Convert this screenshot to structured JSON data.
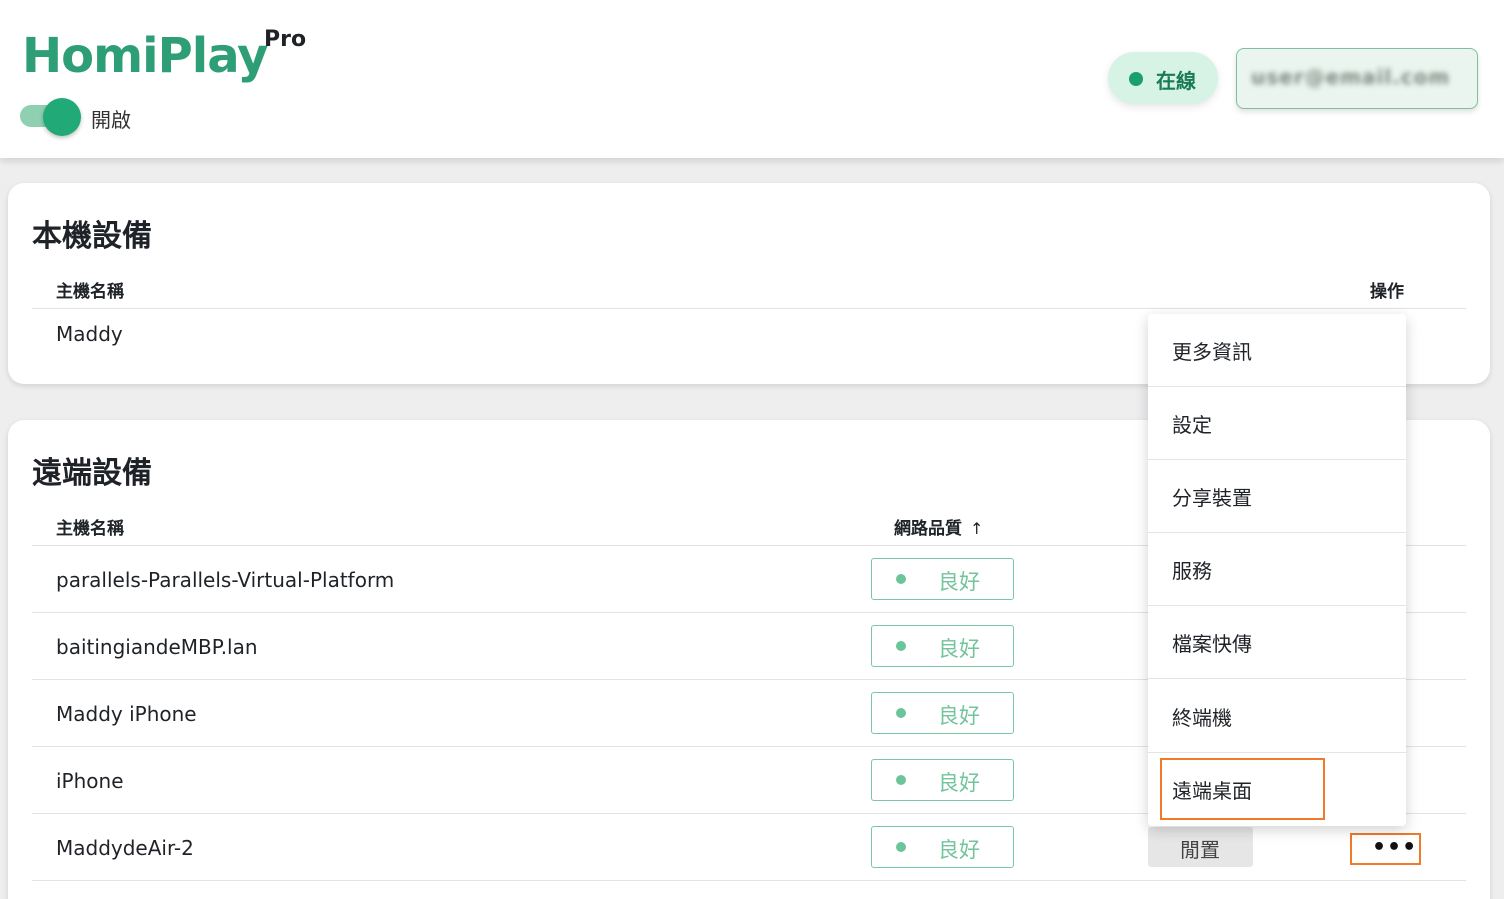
{
  "header": {
    "logo": "HomiPlay",
    "logo_suffix": "Pro",
    "toggle_label": "開啟",
    "status": "在線",
    "account_email": "user@email.com"
  },
  "local": {
    "title": "本機設備",
    "col_name": "主機名稱",
    "col_action": "操作",
    "rows": [
      {
        "name": "Maddy"
      }
    ]
  },
  "remote": {
    "title": "遠端設備",
    "col_name": "主機名稱",
    "col_quality": "網路品質",
    "sort_arrow": "↑",
    "rows": [
      {
        "name": "parallels-Parallels-Virtual-Platform",
        "quality": "良好"
      },
      {
        "name": "baitingiandeMBP.lan",
        "quality": "良好"
      },
      {
        "name": "Maddy iPhone",
        "quality": "良好"
      },
      {
        "name": "iPhone",
        "quality": "良好"
      },
      {
        "name": "MaddydeAir-2",
        "quality": "良好",
        "status": "閒置",
        "more": "•••"
      }
    ]
  },
  "menu": {
    "items": [
      "更多資訊",
      "設定",
      "分享裝置",
      "服務",
      "檔案快傳",
      "終端機",
      "遠端桌面"
    ]
  },
  "colors": {
    "brand": "#2e9e76",
    "online_bg": "#d6f3e6",
    "quality_green": "#72c49c",
    "highlight": "#ef7a2a"
  }
}
